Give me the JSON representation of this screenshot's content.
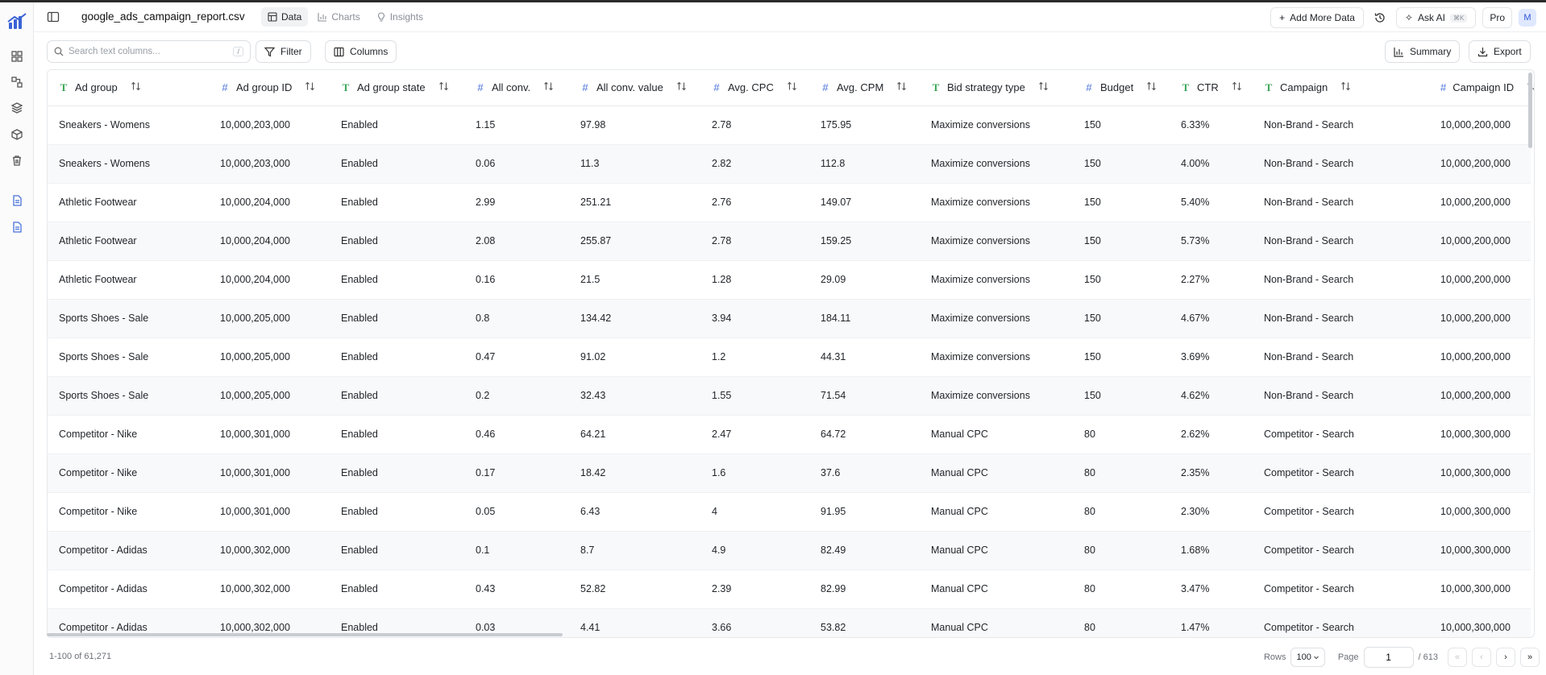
{
  "header": {
    "filename": "google_ads_campaign_report.csv",
    "tabs": [
      {
        "label": "Data",
        "icon": "table-icon",
        "active": true
      },
      {
        "label": "Charts",
        "icon": "bar-chart-icon",
        "active": false
      },
      {
        "label": "Insights",
        "icon": "lightbulb-icon",
        "active": false
      }
    ],
    "add_more_data": "Add More Data",
    "ask_ai": "Ask AI",
    "ask_ai_shortcut": "⌘K",
    "pro": "Pro",
    "avatar": "M"
  },
  "toolbar": {
    "search_placeholder": "Search text columns...",
    "search_shortcut": "/",
    "filter": "Filter",
    "columns": "Columns",
    "summary": "Summary",
    "export": "Export"
  },
  "table": {
    "columns": [
      {
        "name": "Ad group",
        "type": "text"
      },
      {
        "name": "Ad group ID",
        "type": "number"
      },
      {
        "name": "Ad group state",
        "type": "text"
      },
      {
        "name": "All conv.",
        "type": "number"
      },
      {
        "name": "All conv. value",
        "type": "number"
      },
      {
        "name": "Avg. CPC",
        "type": "number"
      },
      {
        "name": "Avg. CPM",
        "type": "number"
      },
      {
        "name": "Bid strategy type",
        "type": "text"
      },
      {
        "name": "Budget",
        "type": "number"
      },
      {
        "name": "CTR",
        "type": "text"
      },
      {
        "name": "Campaign",
        "type": "text"
      },
      {
        "name": "Campaign ID",
        "type": "number"
      }
    ],
    "rows": [
      [
        "Sneakers - Womens",
        "10,000,203,000",
        "Enabled",
        "1.15",
        "97.98",
        "2.78",
        "175.95",
        "Maximize conversions",
        "150",
        "6.33%",
        "Non-Brand - Search",
        "10,000,200,000"
      ],
      [
        "Sneakers - Womens",
        "10,000,203,000",
        "Enabled",
        "0.06",
        "11.3",
        "2.82",
        "112.8",
        "Maximize conversions",
        "150",
        "4.00%",
        "Non-Brand - Search",
        "10,000,200,000"
      ],
      [
        "Athletic Footwear",
        "10,000,204,000",
        "Enabled",
        "2.99",
        "251.21",
        "2.76",
        "149.07",
        "Maximize conversions",
        "150",
        "5.40%",
        "Non-Brand - Search",
        "10,000,200,000"
      ],
      [
        "Athletic Footwear",
        "10,000,204,000",
        "Enabled",
        "2.08",
        "255.87",
        "2.78",
        "159.25",
        "Maximize conversions",
        "150",
        "5.73%",
        "Non-Brand - Search",
        "10,000,200,000"
      ],
      [
        "Athletic Footwear",
        "10,000,204,000",
        "Enabled",
        "0.16",
        "21.5",
        "1.28",
        "29.09",
        "Maximize conversions",
        "150",
        "2.27%",
        "Non-Brand - Search",
        "10,000,200,000"
      ],
      [
        "Sports Shoes - Sale",
        "10,000,205,000",
        "Enabled",
        "0.8",
        "134.42",
        "3.94",
        "184.11",
        "Maximize conversions",
        "150",
        "4.67%",
        "Non-Brand - Search",
        "10,000,200,000"
      ],
      [
        "Sports Shoes - Sale",
        "10,000,205,000",
        "Enabled",
        "0.47",
        "91.02",
        "1.2",
        "44.31",
        "Maximize conversions",
        "150",
        "3.69%",
        "Non-Brand - Search",
        "10,000,200,000"
      ],
      [
        "Sports Shoes - Sale",
        "10,000,205,000",
        "Enabled",
        "0.2",
        "32.43",
        "1.55",
        "71.54",
        "Maximize conversions",
        "150",
        "4.62%",
        "Non-Brand - Search",
        "10,000,200,000"
      ],
      [
        "Competitor - Nike",
        "10,000,301,000",
        "Enabled",
        "0.46",
        "64.21",
        "2.47",
        "64.72",
        "Manual CPC",
        "80",
        "2.62%",
        "Competitor - Search",
        "10,000,300,000"
      ],
      [
        "Competitor - Nike",
        "10,000,301,000",
        "Enabled",
        "0.17",
        "18.42",
        "1.6",
        "37.6",
        "Manual CPC",
        "80",
        "2.35%",
        "Competitor - Search",
        "10,000,300,000"
      ],
      [
        "Competitor - Nike",
        "10,000,301,000",
        "Enabled",
        "0.05",
        "6.43",
        "4",
        "91.95",
        "Manual CPC",
        "80",
        "2.30%",
        "Competitor - Search",
        "10,000,300,000"
      ],
      [
        "Competitor - Adidas",
        "10,000,302,000",
        "Enabled",
        "0.1",
        "8.7",
        "4.9",
        "82.49",
        "Manual CPC",
        "80",
        "1.68%",
        "Competitor - Search",
        "10,000,300,000"
      ],
      [
        "Competitor - Adidas",
        "10,000,302,000",
        "Enabled",
        "0.43",
        "52.82",
        "2.39",
        "82.99",
        "Manual CPC",
        "80",
        "3.47%",
        "Competitor - Search",
        "10,000,300,000"
      ],
      [
        "Competitor - Adidas",
        "10,000,302,000",
        "Enabled",
        "0.03",
        "4.41",
        "3.66",
        "53.82",
        "Manual CPC",
        "80",
        "1.47%",
        "Competitor - Search",
        "10,000,300,000"
      ]
    ]
  },
  "footer": {
    "row_range": "1-100 of 61,271",
    "rows_label": "Rows",
    "rows_per_page": "100",
    "page_label": "Page",
    "current_page": "1",
    "total_pages": "/ 613"
  },
  "colors": {
    "text_type": "#3aa657",
    "number_type": "#4a72d9",
    "accent": "#3156d4"
  }
}
